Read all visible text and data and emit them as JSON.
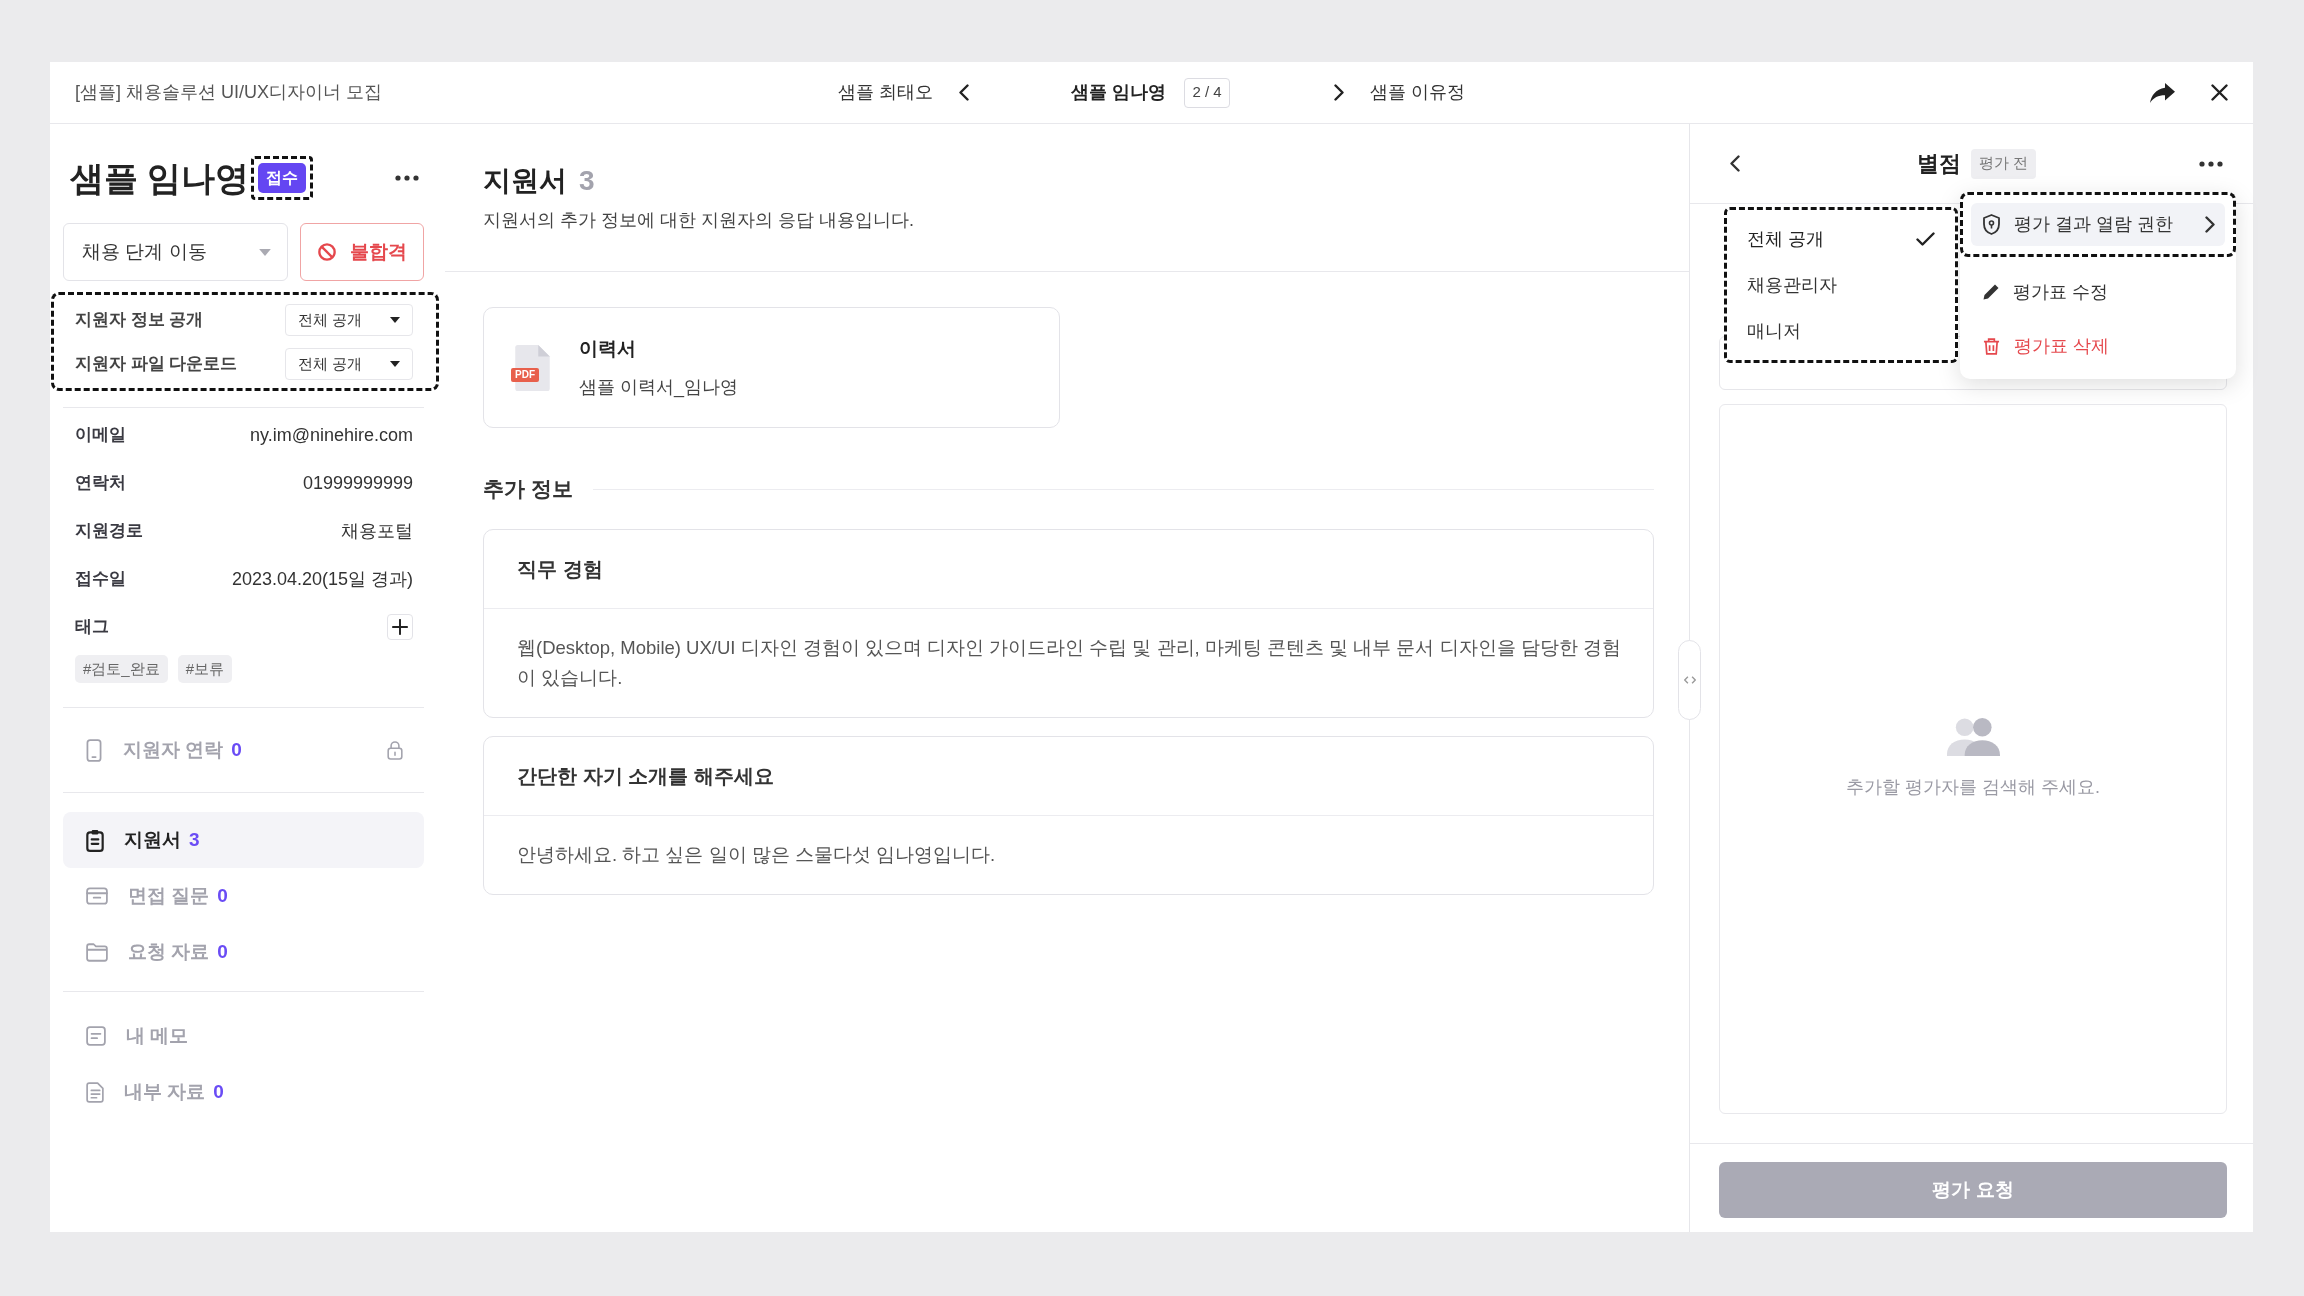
{
  "top_bar": {
    "job_title": "[샘플] 채용솔루션 UI/UX디자이너 모집",
    "previous": "샘플 최태오",
    "current": "샘플 임나영",
    "position": "2 / 4",
    "next": "샘플 이유정"
  },
  "candidate": {
    "name": "샘플 임나영",
    "status": {
      "label": "접수",
      "annotated": true
    }
  },
  "stage_select": {
    "value": "채용 단계 이동"
  },
  "reject_button": {
    "label": "불합격"
  },
  "disclosure": {
    "annotated": true,
    "rows": [
      {
        "label": "지원자 정보 공개",
        "value": "전체 공개"
      },
      {
        "label": "지원자 파일 다운로드",
        "value": "전체 공개"
      }
    ]
  },
  "details": [
    {
      "label": "이메일",
      "value": "ny.im@ninehire.com"
    },
    {
      "label": "연락처",
      "value": "01999999999"
    },
    {
      "label": "지원경로",
      "value": "채용포털"
    },
    {
      "label": "접수일",
      "value": "2023.04.20(15일 경과)"
    }
  ],
  "tags": {
    "label": "태그",
    "items": [
      "#검토_완료",
      "#보류"
    ]
  },
  "contact": {
    "label": "지원자 연락",
    "count": "0",
    "locked": true
  },
  "sidebar": {
    "groups": [
      {
        "items": [
          {
            "kind": "form",
            "label": "지원서",
            "count": "3",
            "selected": true
          },
          {
            "kind": "questions",
            "label": "면접 질문",
            "count": "0",
            "selected": false
          },
          {
            "kind": "files",
            "label": "요청 자료",
            "count": "0",
            "selected": false
          }
        ]
      },
      {
        "items": [
          {
            "kind": "memo",
            "label": "내 메모",
            "selected": false
          },
          {
            "kind": "docs",
            "label": "내부 자료",
            "count": "0",
            "selected": false
          }
        ]
      }
    ]
  },
  "content": {
    "title": "지원서",
    "count": "3",
    "description": "지원서의 추가 정보에 대한 지원자의 응답 내용입니다.",
    "attachment": {
      "file_type": "PDF",
      "title": "이력서",
      "file_name": "샘플 이력서_임나영"
    },
    "section_title": "추가 정보",
    "answers": [
      {
        "question": "직무 경험",
        "answer": "웹(Desktop, Mobile) UX/UI 디자인 경험이 있으며 디자인 가이드라인 수립 및 관리, 마케팅 콘텐츠 및 내부 문서 디자인을 담당한 경험이 있습니다."
      },
      {
        "question": "간단한 자기 소개를 해주세요",
        "answer": "안녕하세요. 하고 싶은 일이 많은 스물다섯 임나영입니다."
      }
    ]
  },
  "evaluation": {
    "title": "별점",
    "status": "평가 전",
    "empty_message": "추가할 평가자를 검색해 주세요.",
    "submit": {
      "label": "평가 요청",
      "disabled": true
    }
  },
  "action_menu": {
    "items": [
      {
        "kind": "permission",
        "label": "평가 결과 열람 권한",
        "active": true,
        "annotated": true
      },
      {
        "kind": "edit",
        "label": "평가표 수정",
        "active": false,
        "annotated": false
      },
      {
        "kind": "delete",
        "label": "평가표 삭제",
        "active": false,
        "annotated": false
      }
    ]
  },
  "permission_submenu": {
    "annotated": true,
    "options": [
      {
        "label": "전체 공개",
        "selected": true
      },
      {
        "label": "채용관리자",
        "selected": false
      },
      {
        "label": "매니저",
        "selected": false
      }
    ]
  }
}
